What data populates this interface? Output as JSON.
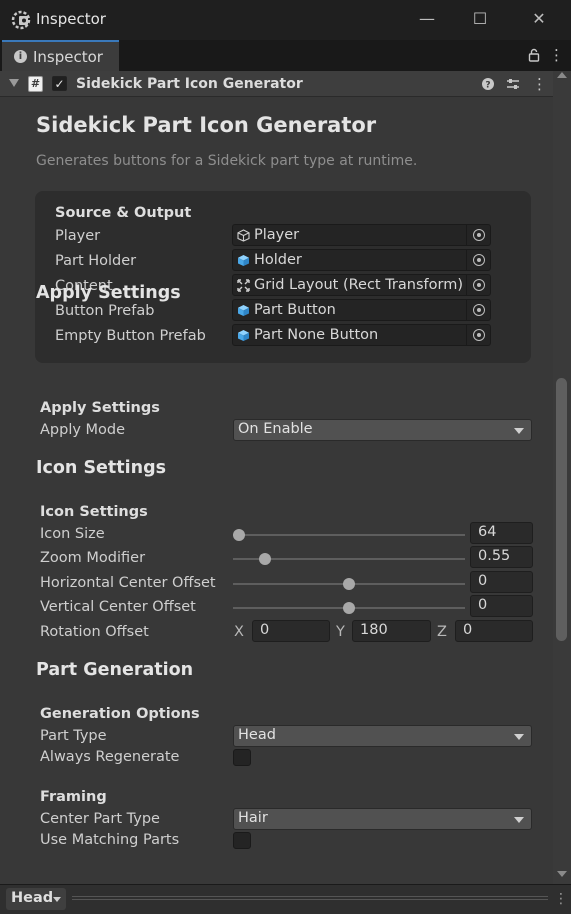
{
  "window": {
    "title": "Inspector",
    "minimize_glyph": "—",
    "maximize_glyph": "☐",
    "close_glyph": "✕"
  },
  "tab": {
    "label": "Inspector",
    "icon": "info-icon"
  },
  "component": {
    "title": "Sidekick Part Icon Generator",
    "enabled": true,
    "header_icons": [
      "help-icon",
      "preset-icon",
      "kebab-menu-icon"
    ]
  },
  "editor": {
    "title": "Sidekick Part Icon Generator",
    "description": "Generates buttons for a Sidekick part type at runtime.",
    "source_output": {
      "heading": "Source & Output",
      "fields": [
        {
          "label": "Player",
          "value": "Player",
          "icon": "gameobject-outline-icon"
        },
        {
          "label": "Part Holder",
          "value": "Holder",
          "icon": "gameobject-cube-icon"
        },
        {
          "label": "Content",
          "value": "Grid Layout (Rect Transform)",
          "icon": "rect-transform-icon"
        },
        {
          "label": "Button Prefab",
          "value": "Part Button",
          "icon": "prefab-cube-icon"
        },
        {
          "label": "Empty Button Prefab",
          "value": "Part None Button",
          "icon": "prefab-cube-icon"
        }
      ]
    },
    "apply": {
      "section": "Apply Settings",
      "group": "Apply Settings",
      "mode_label": "Apply Mode",
      "mode_value": "On Enable"
    },
    "icon": {
      "section": "Icon Settings",
      "group": "Icon Settings",
      "sliders": [
        {
          "label": "Icon Size",
          "value": "64",
          "fraction": 0.0
        },
        {
          "label": "Zoom Modifier",
          "value": "0.55",
          "fraction": 0.12
        },
        {
          "label": "Horizontal Center Offset",
          "value": "0",
          "fraction": 0.5
        },
        {
          "label": "Vertical Center Offset",
          "value": "0",
          "fraction": 0.5
        }
      ],
      "rotation": {
        "label": "Rotation Offset",
        "x_label": "X",
        "x": "0",
        "y_label": "Y",
        "y": "180",
        "z_label": "Z",
        "z": "0"
      }
    },
    "generation": {
      "section": "Part Generation",
      "options_group": "Generation Options",
      "part_type_label": "Part Type",
      "part_type_value": "Head",
      "always_regen_label": "Always Regenerate",
      "always_regen_checked": false,
      "framing_group": "Framing",
      "center_part_label": "Center Part Type",
      "center_part_value": "Hair",
      "use_matching_label": "Use Matching Parts",
      "use_matching_checked": false
    }
  },
  "footer": {
    "preview_label": "Head"
  },
  "colors": {
    "accent": "#3a79bb",
    "panel": "#383838",
    "box": "#2d2d2d",
    "field": "#242424"
  }
}
